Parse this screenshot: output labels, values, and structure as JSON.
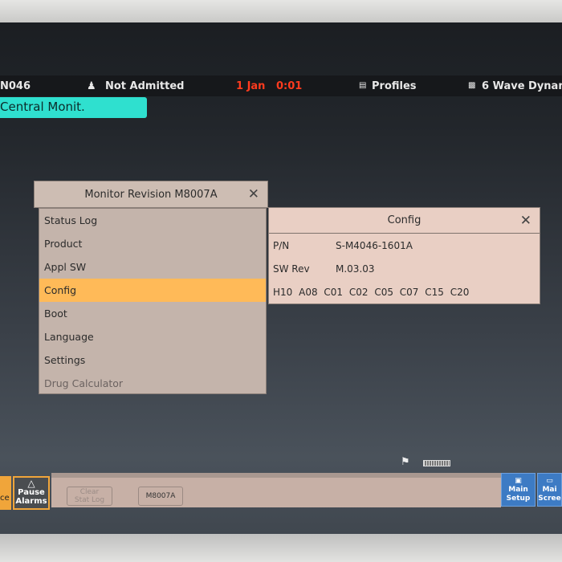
{
  "topbar": {
    "bed": "N046",
    "patient_status": "Not Admitted",
    "date": "1 Jan",
    "time": "0:01",
    "profiles": "Profiles",
    "screen": "6 Wave Dynam"
  },
  "tag": "Central Monit.",
  "revision_menu": {
    "title": "Monitor Revision M8007A",
    "items": [
      {
        "label": "Status Log"
      },
      {
        "label": "Product"
      },
      {
        "label": "Appl SW"
      },
      {
        "label": "Config",
        "selected": true
      },
      {
        "label": "Boot"
      },
      {
        "label": "Language"
      },
      {
        "label": "Settings"
      },
      {
        "label": "Drug Calculator",
        "disabled": true
      }
    ]
  },
  "config_window": {
    "title": "Config",
    "pn_label": "P/N",
    "pn_value": "S-M4046-1601A",
    "sw_label": "SW Rev",
    "sw_value": "M.03.03",
    "options": "H10 A08 C01 C02 C05 C07 C15 C20"
  },
  "bottombar": {
    "left_partial": "ce",
    "pause_line1": "Pause",
    "pause_line2": "Alarms",
    "clear_line1": "Clear",
    "clear_line2": "Stat Log",
    "m8007a": "M8007A",
    "main_setup_line1": "Main",
    "main_setup_line2": "Setup",
    "main_screen_line1": "Mai",
    "main_screen_line2": "Scree"
  },
  "colors": {
    "selected": "#ffba58",
    "tag": "#2fe0cf",
    "time": "#ff3b1e",
    "accent_blue": "#3d7bc4"
  }
}
